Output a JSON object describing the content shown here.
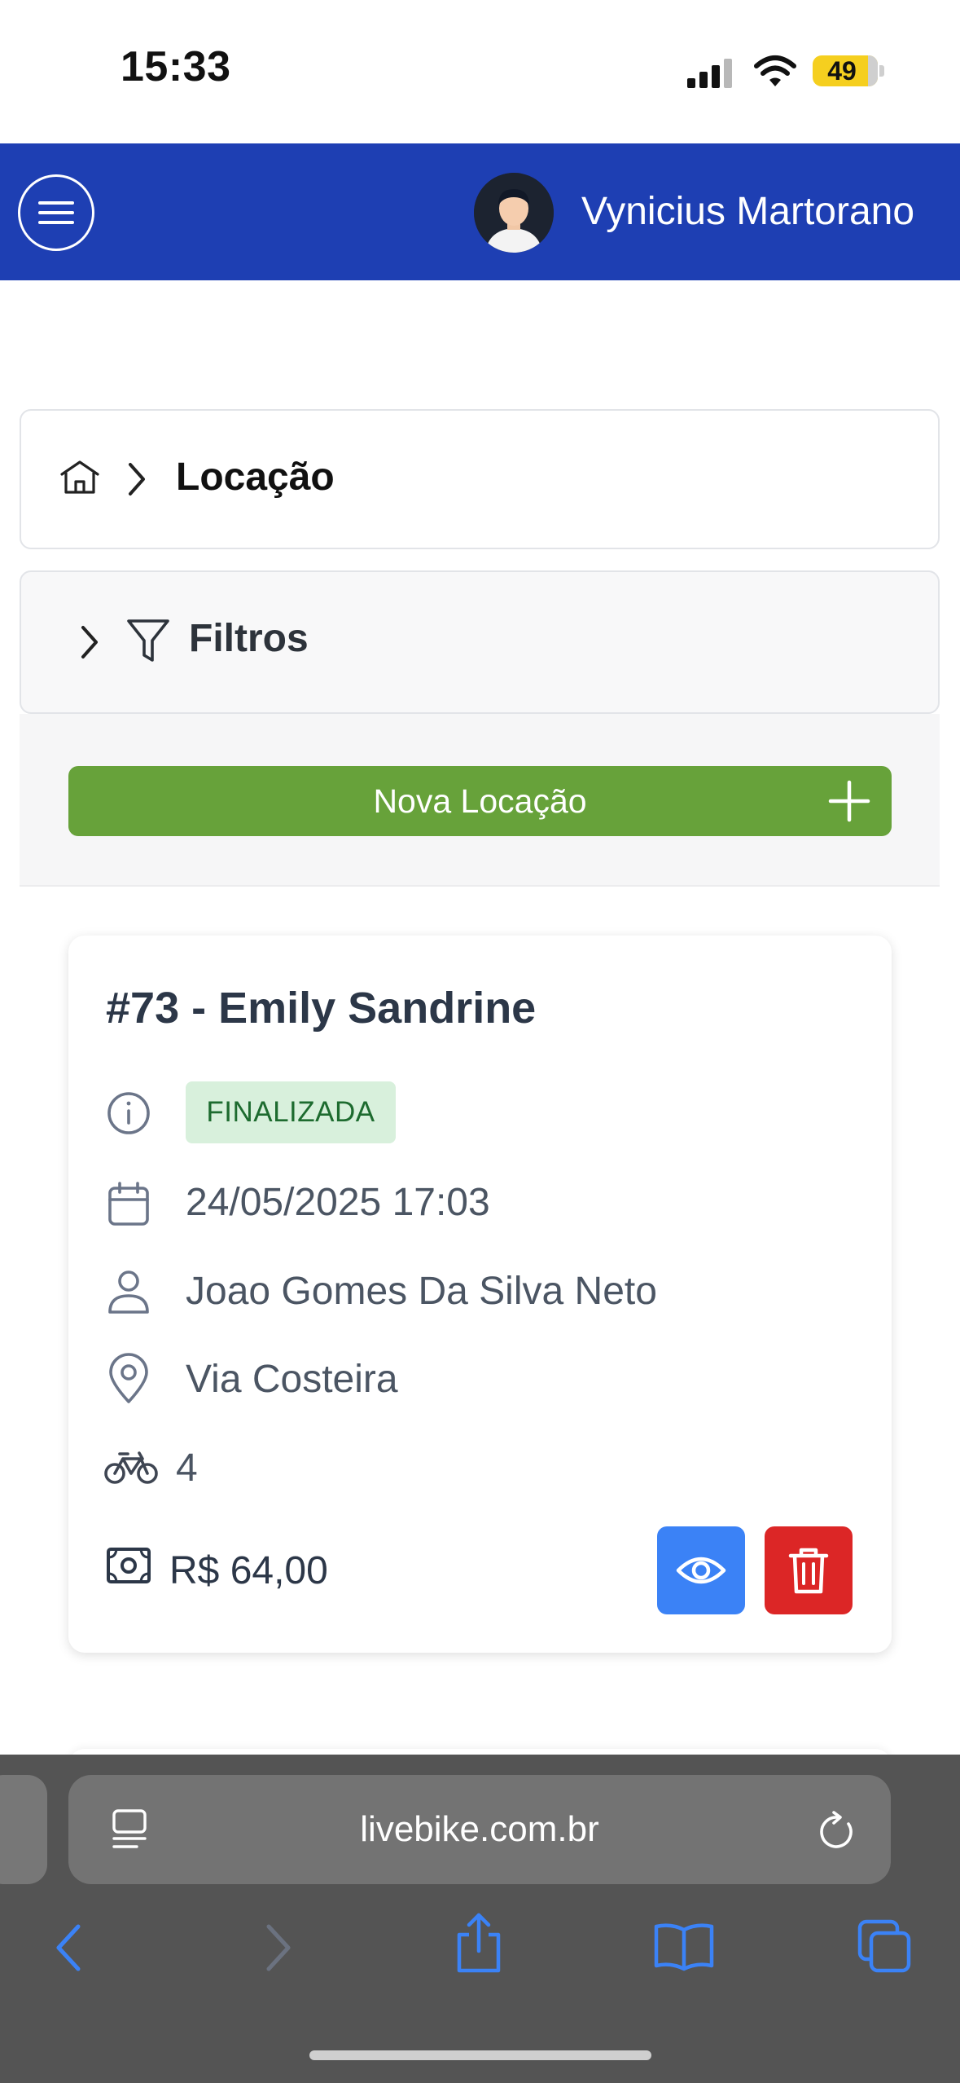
{
  "status_bar": {
    "time": "15:33",
    "battery": "49",
    "icons": [
      "signal-icon",
      "wifi-icon",
      "battery-icon"
    ]
  },
  "header": {
    "menu_icon": "hamburger-menu-icon",
    "user_name": "Vynicius Martorano"
  },
  "breadcrumb": {
    "home_icon": "home-icon",
    "current": "Locação"
  },
  "filters": {
    "label": "Filtros"
  },
  "actions": {
    "new_rental_label": "Nova Locação"
  },
  "rental": {
    "title": "#73 - Emily Sandrine",
    "status": "FINALIZADA",
    "date": "24/05/2025 17:03",
    "person": "Joao Gomes Da Silva Neto",
    "location": "Via Costeira",
    "bikes": "4",
    "price": "R$ 64,00"
  },
  "browser": {
    "url": "livebike.com.br"
  },
  "colors": {
    "header": "#1e3fb3",
    "new_button": "#67a23a",
    "view_button": "#3b82f6",
    "delete_button": "#dc2626",
    "status_badge_bg": "#d8f0dc",
    "status_badge_text": "#1d6b2f",
    "browser_accent": "#3b82f6"
  }
}
